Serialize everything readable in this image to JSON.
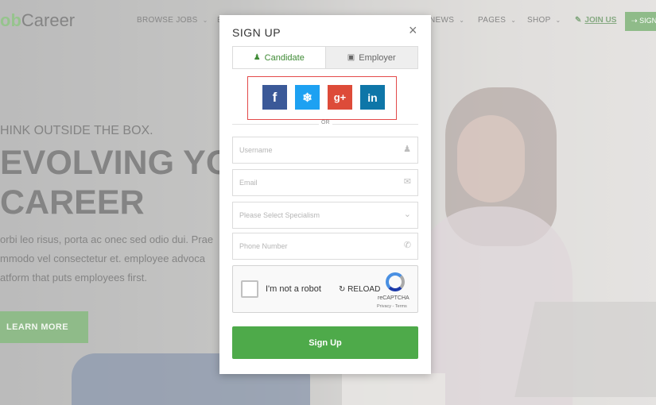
{
  "background": {
    "logo": {
      "prefix": "ob",
      "suffix": "Career"
    },
    "nav": [
      {
        "label": "BROWSE JOBS"
      },
      {
        "label": "E"
      },
      {
        "label": "NEWS"
      },
      {
        "label": "PAGES"
      },
      {
        "label": "SHOP"
      }
    ],
    "join_us": "JOIN US",
    "sign_in": "SIGN",
    "hero": {
      "tagline": "HINK OUTSIDE THE BOX.",
      "headline_1": "EVOLVING YO",
      "headline_2": "CAREER",
      "body_1": "orbi leo risus, porta ac onec sed odio dui. Prae",
      "body_2": "mmodo vel consectetur et.  employee advoca",
      "body_3": "atform that puts employees first.",
      "cta": "LEARN MORE"
    }
  },
  "modal": {
    "title": "SIGN UP",
    "close": "×",
    "tabs": [
      {
        "label": "Candidate",
        "active": true,
        "icon": "user-plus-icon"
      },
      {
        "label": "Employer",
        "active": false,
        "icon": "briefcase-icon"
      }
    ],
    "social": [
      {
        "name": "facebook",
        "glyph": "f"
      },
      {
        "name": "twitter",
        "glyph": "❝"
      },
      {
        "name": "google-plus",
        "glyph": "g+"
      },
      {
        "name": "linkedin",
        "glyph": "in"
      }
    ],
    "divider_text": "OR",
    "fields": {
      "username": {
        "placeholder": "Username",
        "icon": "user-icon"
      },
      "email": {
        "placeholder": "Email",
        "icon": "envelope-icon"
      },
      "specialism": {
        "placeholder": "Please Select Specialism",
        "icon": "chevron-down-icon"
      },
      "phone": {
        "placeholder": "Phone Number",
        "icon": "phone-icon"
      }
    },
    "captcha": {
      "label": "I'm not a robot",
      "reload": "RELOAD",
      "brand": "reCAPTCHA",
      "terms": "Privacy - Terms"
    },
    "submit": "Sign Up"
  },
  "colors": {
    "accent_green": "#4eaa4a",
    "brand_green": "#3f8b35",
    "highlight_red": "#e34a4a"
  }
}
